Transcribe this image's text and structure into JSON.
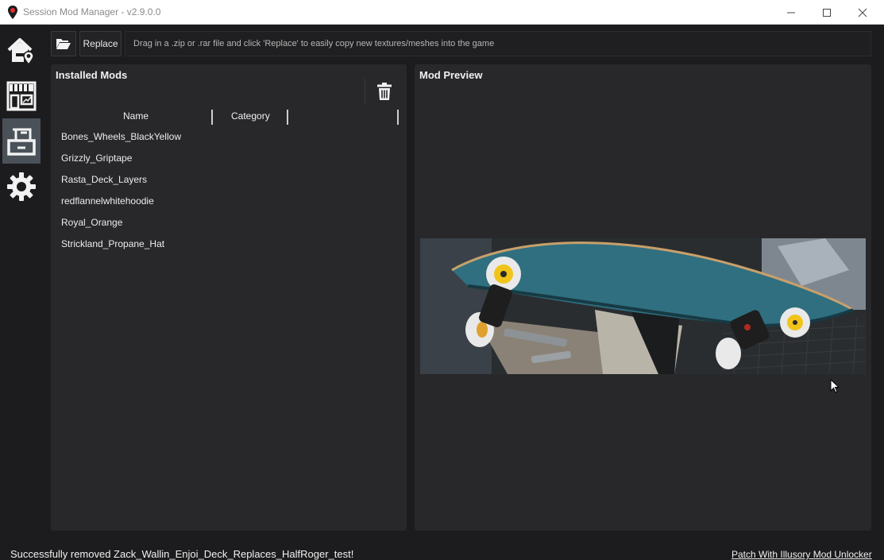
{
  "window": {
    "title": "Session Mod Manager - v2.9.0.0",
    "controls": [
      "minimize",
      "maximize",
      "close"
    ]
  },
  "nav": {
    "items": [
      {
        "name": "home",
        "icon": "home-location-icon",
        "active": false
      },
      {
        "name": "store",
        "icon": "storefront-icon",
        "active": false
      },
      {
        "name": "installed-mods",
        "icon": "drawer-icon",
        "active": true
      },
      {
        "name": "settings",
        "icon": "gear-icon",
        "active": false
      }
    ]
  },
  "toolbar": {
    "open_icon": "folder-open-icon",
    "replace_label": "Replace",
    "hint": "Drag in a .zip or .rar file and click 'Replace' to easily copy new textures/meshes into the game"
  },
  "installed": {
    "title": "Installed Mods",
    "delete_icon": "trash-icon",
    "columns": [
      "Name",
      "Category"
    ],
    "mods": [
      "Bones_Wheels_BlackYellow",
      "Grizzly_Griptape",
      "Rasta_Deck_Layers",
      "redflannelwhitehoodie",
      "Royal_Orange",
      "Strickland_Propane_Hat"
    ]
  },
  "preview": {
    "title": "Mod Preview",
    "image": "skateboard-deck-preview-image"
  },
  "status": {
    "message": "Successfully removed Zack_Wallin_Enjoi_Deck_Replaces_HalfRoger_test!",
    "patch_link": "Patch With Illusory Mod Unlocker"
  },
  "colors": {
    "background": "#1c1c1e",
    "panel": "#28282b",
    "nav_active": "#4a5159",
    "accent_red": "#e0312f",
    "deck_teal": "#2f6f80",
    "wheel_yellow": "#f0c419"
  }
}
